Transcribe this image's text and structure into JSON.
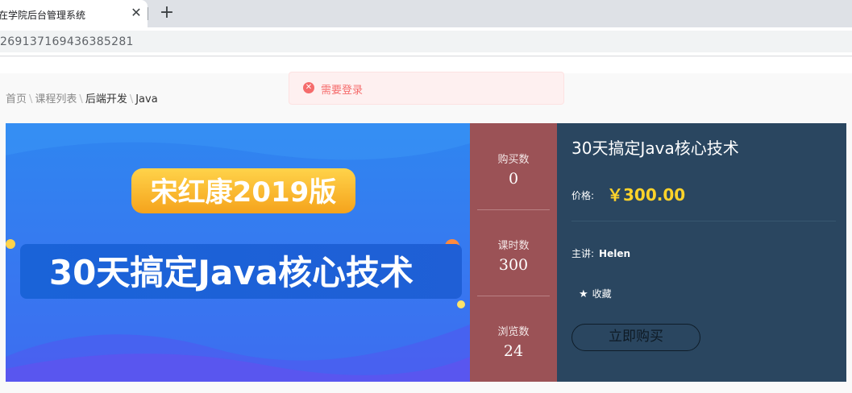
{
  "browser": {
    "tab_title": "在学院后台管理系统",
    "close_glyph": "✕",
    "new_tab_glyph": "+",
    "url": "269137169436385281"
  },
  "toast": {
    "icon": "✕",
    "message": "需要登录"
  },
  "breadcrumb": {
    "items": [
      "首页",
      "课程列表",
      "后端开发",
      "Java"
    ],
    "separator": "\\"
  },
  "banner": {
    "edition": "宋红康2019版",
    "headline": "30天搞定Java核心技术"
  },
  "stats": [
    {
      "label": "购买数",
      "value": "0"
    },
    {
      "label": "课时数",
      "value": "300"
    },
    {
      "label": "浏览数",
      "value": "24"
    }
  ],
  "course": {
    "title": "30天搞定Java核心技术",
    "price_label": "价格:",
    "price": "￥300.00",
    "teacher_label": "主讲:",
    "teacher_name": "Helen",
    "favorite_label": "收藏",
    "buy_label": "立即购买"
  },
  "colors": {
    "stats_bg": "#9b5256",
    "info_bg": "#2a4660",
    "price": "#ffd32a",
    "toast_text": "#f56c6c"
  }
}
